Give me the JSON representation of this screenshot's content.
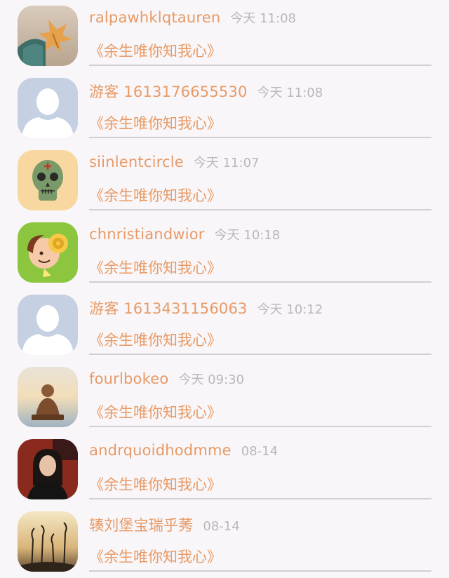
{
  "comments": [
    {
      "name": "ralpawhklqtauren",
      "time": "今天 11:08",
      "text": "《余生唯你知我心》",
      "avatar": "autumn-leaf-hand-avatar"
    },
    {
      "name": "游客 1613176655530",
      "time": "今天 11:08",
      "text": "《余生唯你知我心》",
      "avatar": "default-guest-avatar"
    },
    {
      "name": "siinlentcircle",
      "time": "今天 11:07",
      "text": "《余生唯你知我心》",
      "avatar": "sugar-skull-avatar"
    },
    {
      "name": "chnristiandwior",
      "time": "今天 10:18",
      "text": "《余生唯你知我心》",
      "avatar": "cartoon-sheep-avatar"
    },
    {
      "name": "游客 1613431156063",
      "time": "今天 10:12",
      "text": "《余生唯你知我心》",
      "avatar": "default-guest-avatar"
    },
    {
      "name": "fourlbokeo",
      "time": "今天 09:30",
      "text": "《余生唯你知我心》",
      "avatar": "buddha-statue-avatar"
    },
    {
      "name": "andrquoidhodmme",
      "time": "08-14",
      "text": "《余生唯你知我心》",
      "avatar": "girl-portrait-avatar"
    },
    {
      "name": "辏刘堡宝瑞乎莠",
      "time": "08-14",
      "text": "《余生唯你知我心》",
      "avatar": "reeds-sunset-avatar"
    }
  ],
  "colors": {
    "name": "#e89a66",
    "message": "#e89a66",
    "time": "#b9b7ba",
    "divider": "#d1cfd2",
    "background": "#f8f6f8"
  }
}
